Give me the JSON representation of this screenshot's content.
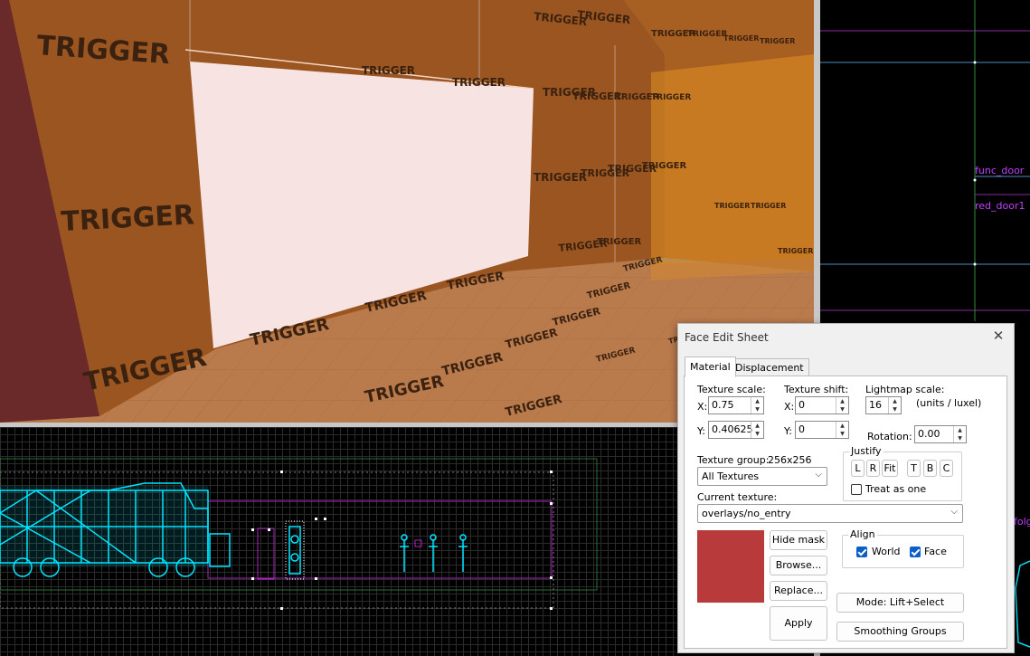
{
  "viewport3d": {
    "trigger_text": "TRIGGER",
    "colors": {
      "wall": "#9a5520",
      "floor": "#b97a4c",
      "selected_face": "#f8e3e3",
      "glass": "#e08f22",
      "left_wall": "#6b2a2a"
    }
  },
  "viewport_top": {
    "entity_label_1": "func_door",
    "entity_label_2": "red_door1"
  },
  "viewport_side": {
    "fragment_label": "folg"
  },
  "face_edit_sheet": {
    "title": "Face Edit Sheet",
    "close_glyph": "✕",
    "tabs": [
      {
        "label": "Material"
      },
      {
        "label": "Displacement"
      }
    ],
    "texture_scale": {
      "label": "Texture scale:",
      "x_label": "X:",
      "x_value": "0.75",
      "y_label": "Y:",
      "y_value": "0.40625"
    },
    "texture_shift": {
      "label": "Texture shift:",
      "x_label": "X:",
      "x_value": "0",
      "y_label": "Y:",
      "y_value": "0"
    },
    "lightmap": {
      "label": "Lightmap scale:",
      "value": "16",
      "units": "(units / luxel)"
    },
    "rotation": {
      "label": "Rotation:",
      "value": "0.00"
    },
    "texture_group": {
      "label": "Texture group:",
      "size": "256x256",
      "selected": "All Textures"
    },
    "justify": {
      "label": "Justify",
      "buttons": [
        "L",
        "R",
        "Fit",
        "T",
        "B",
        "C"
      ],
      "treat_as_one": "Treat as one",
      "treat_as_one_checked": false
    },
    "current_texture": {
      "label": "Current texture:",
      "value": "overlays/no_entry"
    },
    "swatch_color": "#b83a3a",
    "buttons": {
      "hide_mask": "Hide mask",
      "browse": "Browse...",
      "replace": "Replace...",
      "apply": "Apply",
      "mode": "Mode: Lift+Select",
      "smoothing": "Smoothing Groups"
    },
    "align": {
      "label": "Align",
      "world": "World",
      "world_checked": true,
      "face": "Face",
      "face_checked": true
    }
  }
}
